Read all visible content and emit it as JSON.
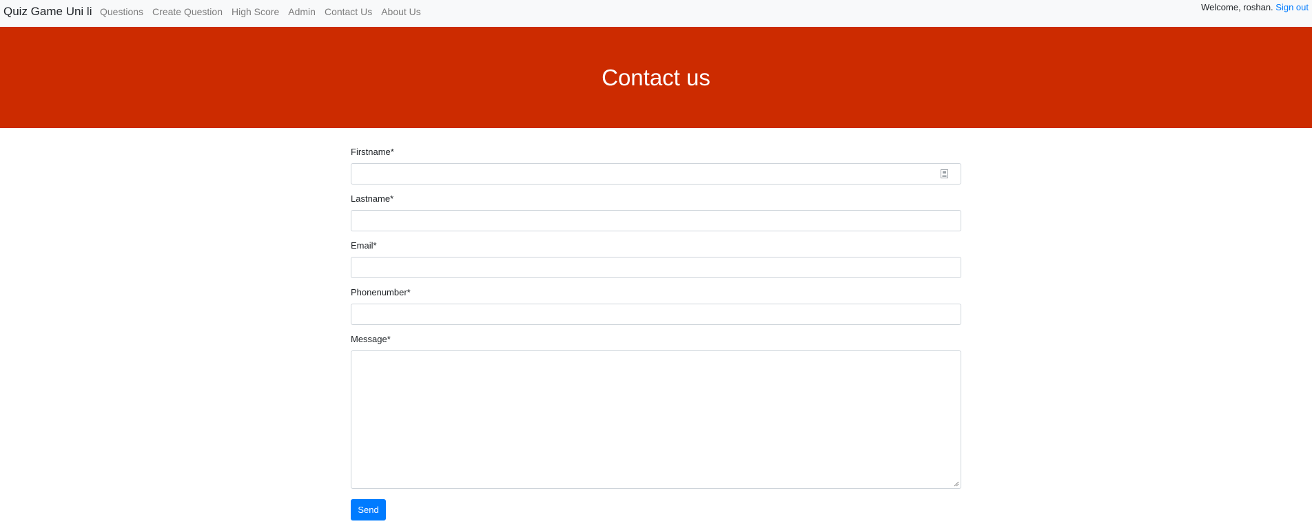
{
  "navbar": {
    "brand": "Quiz Game Uni li",
    "links": [
      "Questions",
      "Create Question",
      "High Score",
      "Admin",
      "Contact Us",
      "About Us"
    ],
    "welcome": "Welcome, roshan.",
    "signout": "Sign out"
  },
  "hero": {
    "title": "Contact us",
    "background": "#cc2b00"
  },
  "form": {
    "firstname_label": "Firstname*",
    "firstname_value": "",
    "lastname_label": "Lastname*",
    "lastname_value": "",
    "email_label": "Email*",
    "email_value": "",
    "phone_label": "Phonenumber*",
    "phone_value": "",
    "message_label": "Message*",
    "message_value": "",
    "send_label": "Send"
  },
  "colors": {
    "accent": "#007bff",
    "navbar_bg": "#f8f9fa"
  }
}
